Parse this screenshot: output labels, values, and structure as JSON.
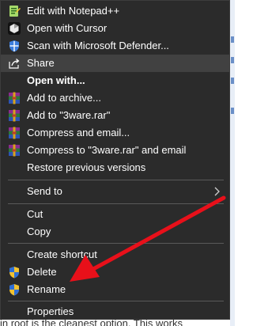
{
  "menu": {
    "items": [
      {
        "label": "Edit with Notepad++",
        "icon": "notepad-plus-plus-icon"
      },
      {
        "label": "Open with Cursor",
        "icon": "cursor-app-icon"
      },
      {
        "label": "Scan with Microsoft Defender...",
        "icon": "defender-shield-icon"
      },
      {
        "label": "Share",
        "icon": "share-icon"
      },
      {
        "label": "Open with..."
      },
      {
        "label": "Add to archive...",
        "icon": "winrar-icon"
      },
      {
        "label": "Add to \"3ware.rar\"",
        "icon": "winrar-icon"
      },
      {
        "label": "Compress and email...",
        "icon": "winrar-icon"
      },
      {
        "label": "Compress to \"3ware.rar\" and email",
        "icon": "winrar-icon"
      },
      {
        "label": "Restore previous versions"
      },
      {
        "label": "Send to",
        "icon": "chevron-right-icon"
      },
      {
        "label": "Cut"
      },
      {
        "label": "Copy"
      },
      {
        "label": "Create shortcut"
      },
      {
        "label": "Delete",
        "icon": "uac-shield-icon"
      },
      {
        "label": "Rename",
        "icon": "uac-shield-icon"
      },
      {
        "label": "Properties"
      }
    ]
  },
  "background": {
    "text": "in root is the cleanest option. This works"
  },
  "colors": {
    "menu_bg": "#2b2b2b",
    "hover_bg": "#414141",
    "separator": "#5a5a5a",
    "annotation_arrow": "#e8101a"
  }
}
